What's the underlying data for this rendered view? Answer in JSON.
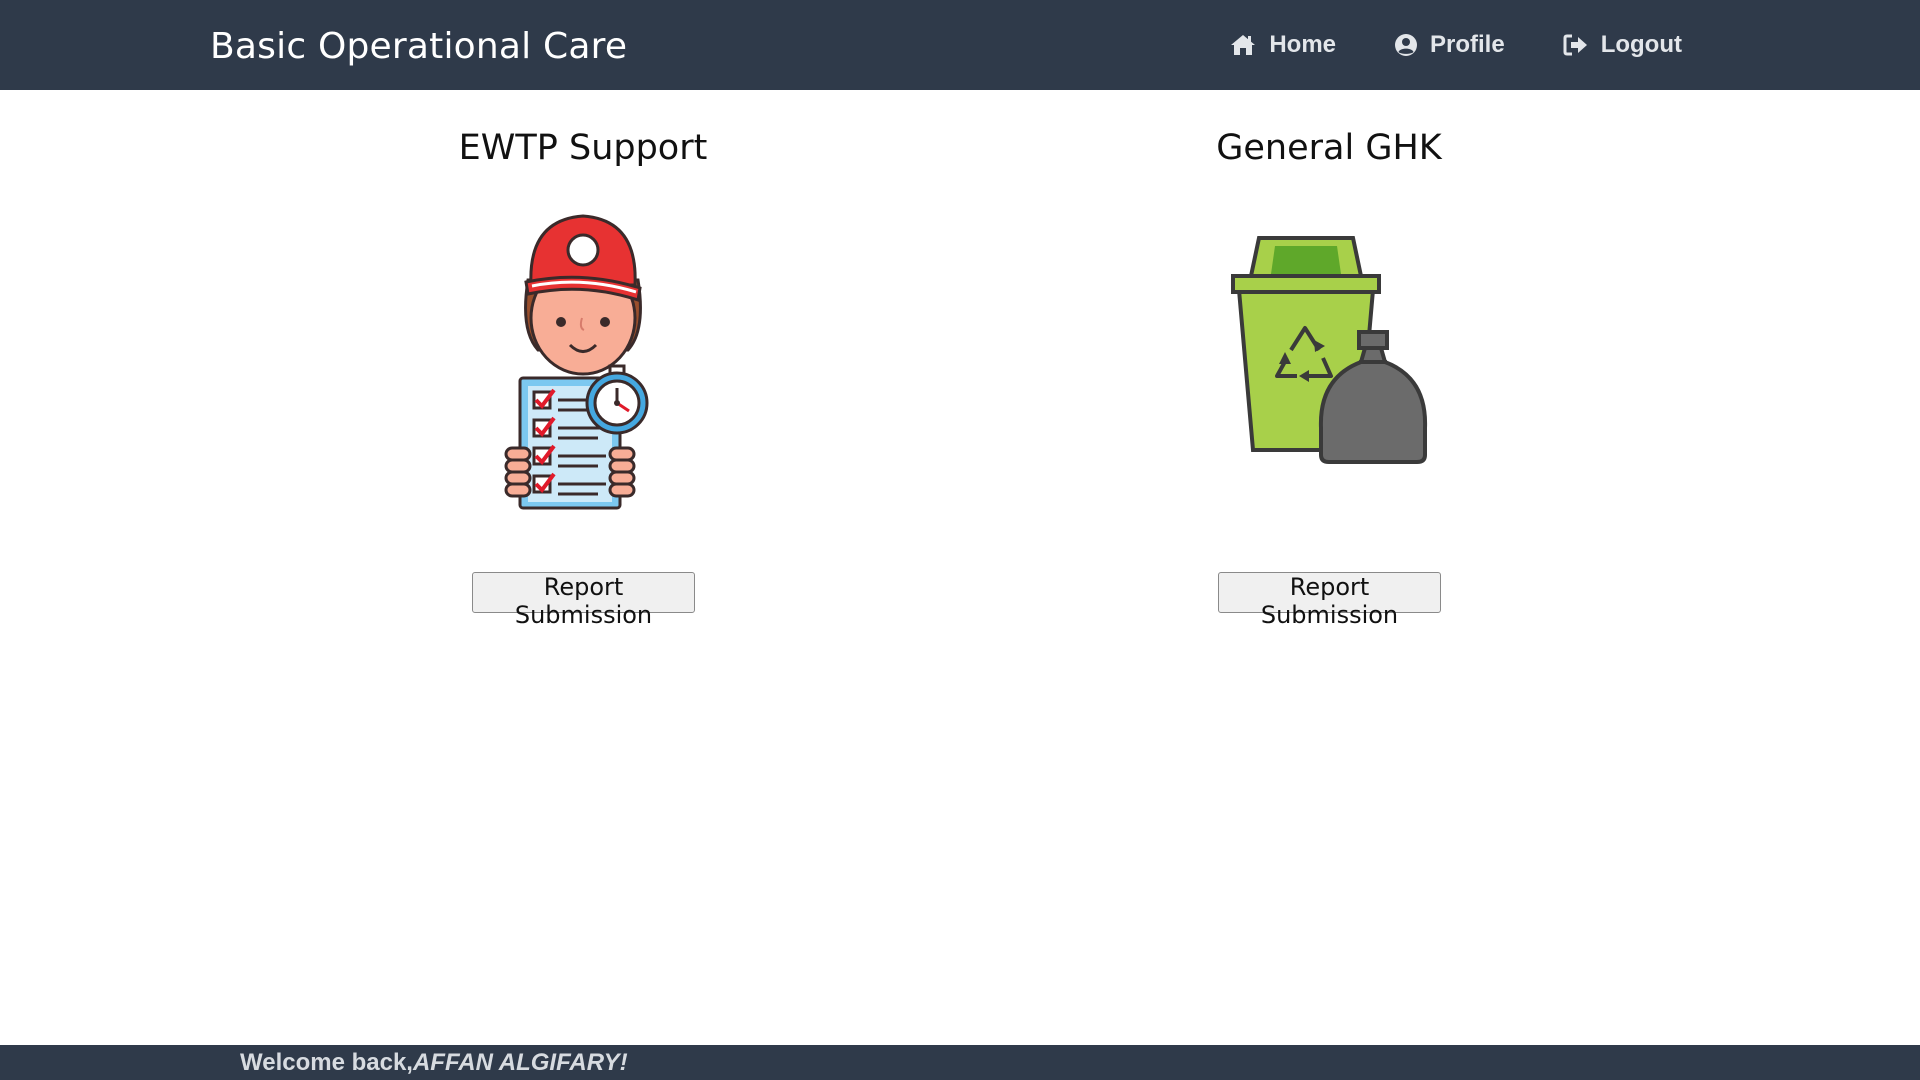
{
  "app": {
    "title": "Basic Operational Care"
  },
  "nav": {
    "items": [
      {
        "label": "Home",
        "icon": "home-icon"
      },
      {
        "label": "Profile",
        "icon": "user-circle-icon"
      },
      {
        "label": "Logout",
        "icon": "logout-icon"
      }
    ]
  },
  "cards": [
    {
      "title": "EWTP Support",
      "illustration": "worker-checklist-stopwatch-icon",
      "button_label": "Report Submission"
    },
    {
      "title": "General GHK",
      "illustration": "recycle-bin-trash-bag-icon",
      "button_label": "Report Submission"
    }
  ],
  "footer": {
    "greeting": "Welcome back,",
    "user": "AFFAN ALGIFARY!"
  },
  "colors": {
    "navbar_bg": "#2f3a4a",
    "page_bg": "#ffffff",
    "nav_text": "#e3e6ea"
  }
}
